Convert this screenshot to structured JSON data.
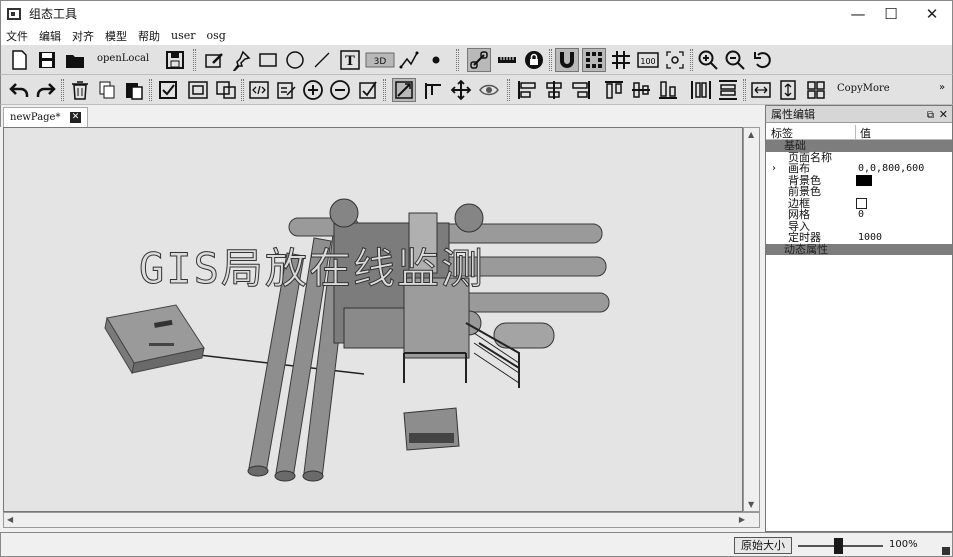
{
  "window": {
    "title": "组态工具",
    "controls": {
      "minimize": "—",
      "maximize": "☐",
      "close": "✕"
    }
  },
  "menu": [
    {
      "label": "文件"
    },
    {
      "label": "编辑"
    },
    {
      "label": "对齐"
    },
    {
      "label": "模型"
    },
    {
      "label": "帮助"
    },
    {
      "label": "user"
    },
    {
      "label": "osg"
    }
  ],
  "toolbar1": {
    "open_local_label": "openLocal",
    "text_tool_label": "T",
    "threed_label": "3D",
    "hundred_label": "100"
  },
  "toolbar2": {
    "copy_more_label": "CopyMore",
    "overflow": "»"
  },
  "tabs": [
    {
      "label": "newPage*",
      "close": "✕"
    }
  ],
  "canvas": {
    "watermark_text": "GIS局放在线监测"
  },
  "panel": {
    "title": "属性编辑",
    "float_icon": "⧉",
    "close_icon": "✕",
    "header_tag": "标签",
    "header_value": "值",
    "rows": [
      {
        "label": "基础",
        "value": ""
      },
      {
        "label": "页面名称",
        "value": ""
      },
      {
        "label": "画布",
        "value": "0,0,800,600",
        "expander": "›"
      },
      {
        "label": "背景色",
        "value": ""
      },
      {
        "label": "前景色",
        "value": ""
      },
      {
        "label": "边框",
        "value": ""
      },
      {
        "label": "网格",
        "value": "0"
      },
      {
        "label": "导入",
        "value": ""
      },
      {
        "label": "定时器",
        "value": "1000"
      },
      {
        "label": "动态属性",
        "value": ""
      }
    ],
    "background_color": "#000000"
  },
  "status": {
    "zoom_reset_label": "原始大小",
    "zoom_percent": "100%"
  },
  "colors": {
    "toolbar_bg": "#e2e2e2",
    "canvas_bg": "#e4e4e4",
    "group_row": "#7d7d7d"
  }
}
